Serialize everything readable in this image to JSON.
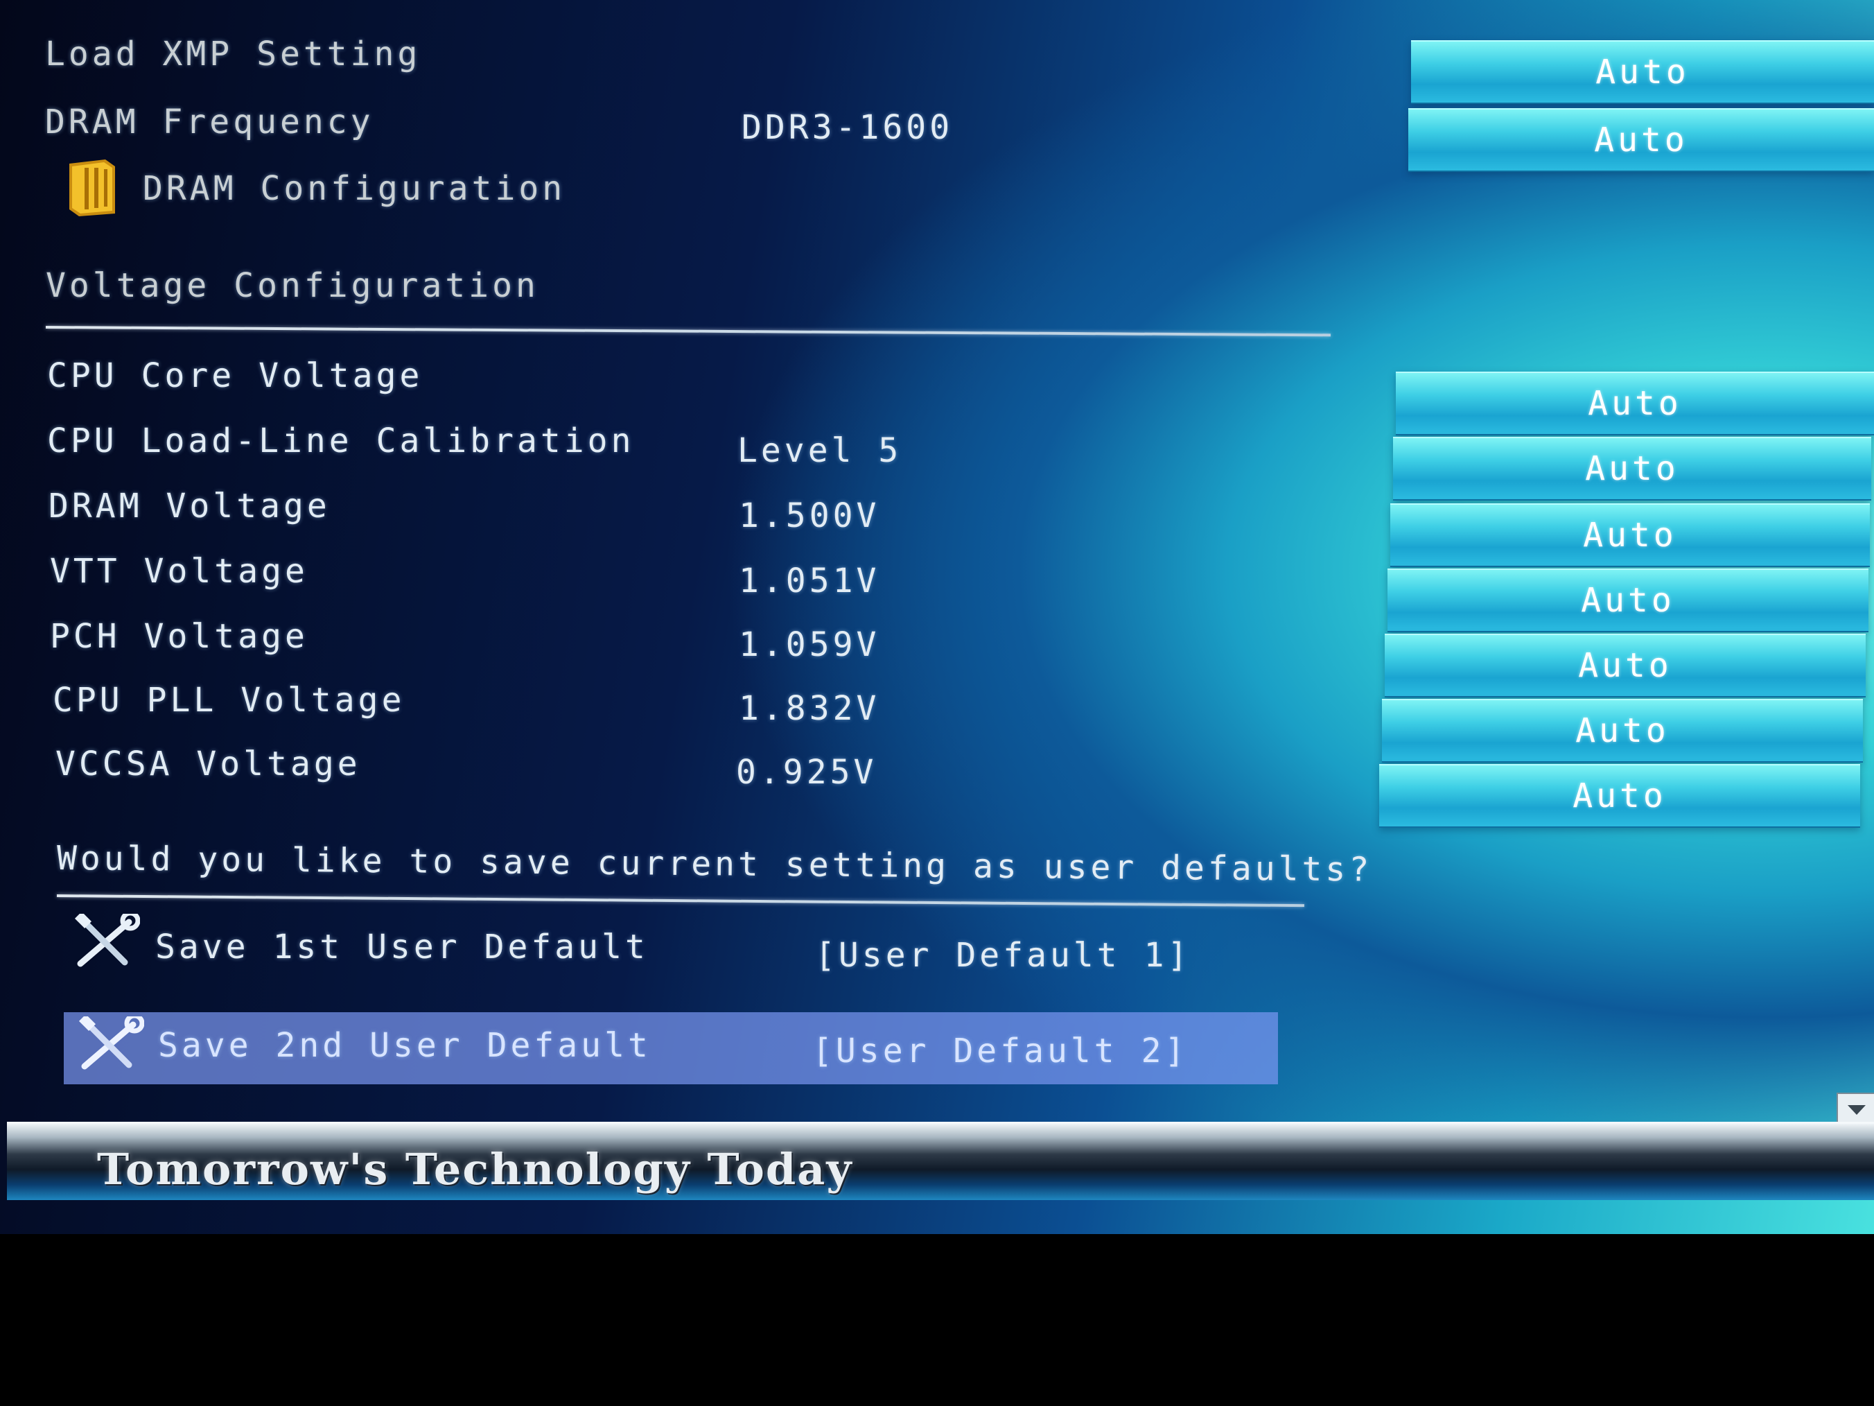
{
  "memory": {
    "load_xmp": {
      "label": "Load XMP Setting",
      "setting": "Auto"
    },
    "dram_frequency": {
      "label": "DRAM Frequency",
      "value": "DDR3-1600",
      "setting": "Auto"
    },
    "dram_configuration": {
      "label": "DRAM Configuration"
    }
  },
  "voltage": {
    "section_title": "Voltage Configuration",
    "rows": [
      {
        "label": "CPU Core Voltage",
        "value": "",
        "setting": "Auto"
      },
      {
        "label": "CPU Load-Line Calibration",
        "value": "Level 5",
        "setting": "Auto"
      },
      {
        "label": "DRAM Voltage",
        "value": "1.500V",
        "setting": "Auto"
      },
      {
        "label": "VTT Voltage",
        "value": "1.051V",
        "setting": "Auto"
      },
      {
        "label": "PCH Voltage",
        "value": "1.059V",
        "setting": "Auto"
      },
      {
        "label": "CPU PLL Voltage",
        "value": "1.832V",
        "setting": "Auto"
      },
      {
        "label": "VCCSA Voltage",
        "value": "0.925V",
        "setting": "Auto"
      }
    ]
  },
  "user_defaults": {
    "prompt": "Would you like to save current setting as user defaults?",
    "save1": {
      "label": "Save 1st User Default",
      "value": "[User Default 1]"
    },
    "save2": {
      "label": "Save 2nd User Default",
      "value": "[User Default 2]"
    }
  },
  "footer": {
    "tagline": "Tomorrow's Technology Today"
  },
  "icons": {
    "dram_configuration": "memory-folder-icon",
    "save1": "wrench-screwdriver-icon",
    "save2": "wrench-screwdriver-icon",
    "scroll": "scroll-down-arrow-icon"
  },
  "colors": {
    "highlight": "#7896f0",
    "button_cyan": "#3fd0e6",
    "text": "#e2ecf4"
  }
}
